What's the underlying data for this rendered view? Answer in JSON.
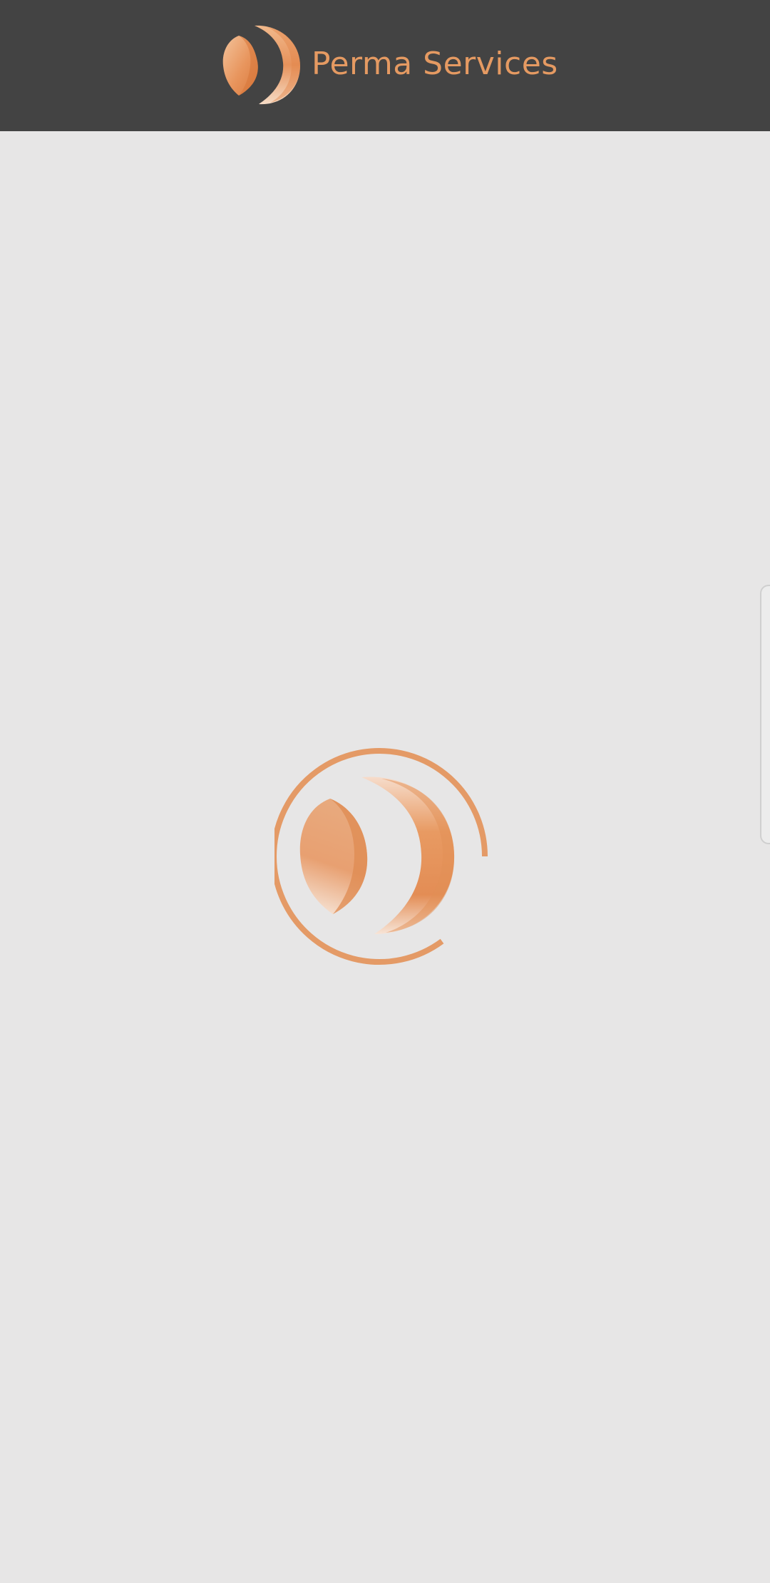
{
  "header": {
    "brand_name": "Perma Services",
    "logo_icon": "perma-services-logo-icon"
  },
  "main": {
    "loader_icon": "loading-spinner-icon",
    "side_tab_icon": "side-drawer-handle"
  },
  "colors": {
    "header_background": "#434343",
    "page_background": "#e7e6e6",
    "brand_orange": "#e59a62"
  }
}
